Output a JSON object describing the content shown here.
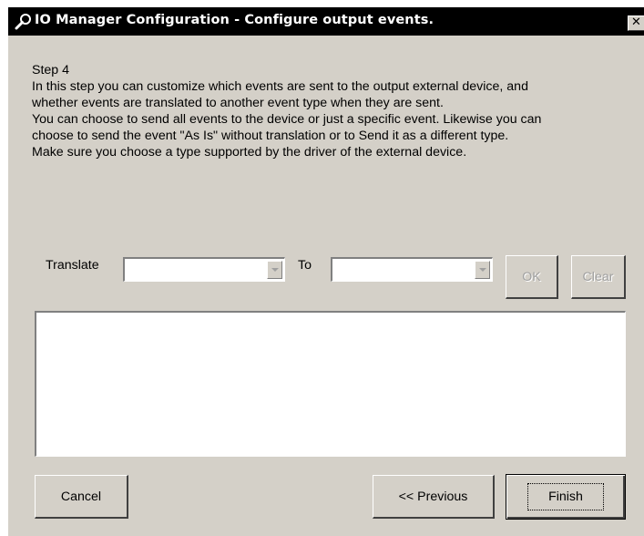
{
  "window": {
    "title": "IO Manager Configuration - Configure output events.",
    "close_glyph": "✕",
    "icon": "wrench-icon"
  },
  "instructions": {
    "step": "Step 4",
    "lines": [
      "In this step you can customize which events are sent to the output external device, and",
      "whether events are translated to another event type when they are sent.",
      "You can choose to send all events to the device or just a specific event. Likewise you can",
      "choose to send the event \"As Is\" without translation or to Send it as a different type.",
      "Make sure you choose a type supported by the driver of the external device."
    ]
  },
  "translate": {
    "label": "Translate",
    "from_value": "",
    "to_label": "To",
    "to_value": "",
    "ok_label": "OK",
    "clear_label": "Clear"
  },
  "events_list": [],
  "footer": {
    "cancel_label": "Cancel",
    "previous_label": "<< Previous",
    "finish_label": "Finish"
  },
  "colors": {
    "window_bg": "#d4d0c8",
    "titlebar_bg": "#000000",
    "titlebar_text": "#ffffff",
    "disabled_text": "#a0a0a0"
  }
}
